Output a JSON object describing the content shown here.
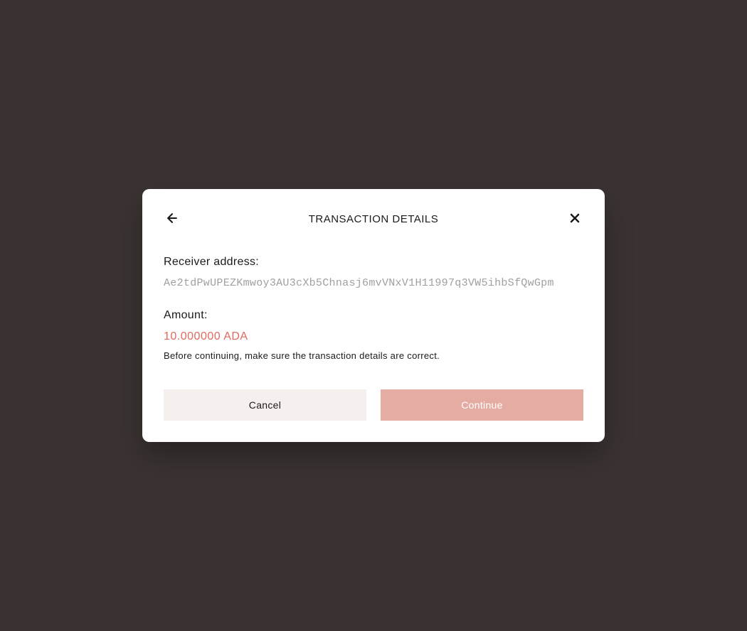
{
  "modal": {
    "title": "TRANSACTION DETAILS",
    "fields": {
      "receiver_address": {
        "label": "Receiver address:",
        "value": "Ae2tdPwUPEZKmwoy3AU3cXb5Chnasj6mvVNxV1H11997q3VW5ihbSfQwGpm"
      },
      "amount": {
        "label": "Amount:",
        "value": "10.000000 ADA"
      }
    },
    "warning_text": "Before continuing, make sure the transaction details are correct.",
    "buttons": {
      "cancel_label": "Cancel",
      "continue_label": "Continue"
    }
  },
  "colors": {
    "background": "#3a3331",
    "modal_bg": "#ffffff",
    "accent_red": "#e06a5d",
    "continue_bg": "#e5aca3",
    "cancel_bg": "#f5f0ee",
    "muted_text": "#a0a0a0"
  }
}
